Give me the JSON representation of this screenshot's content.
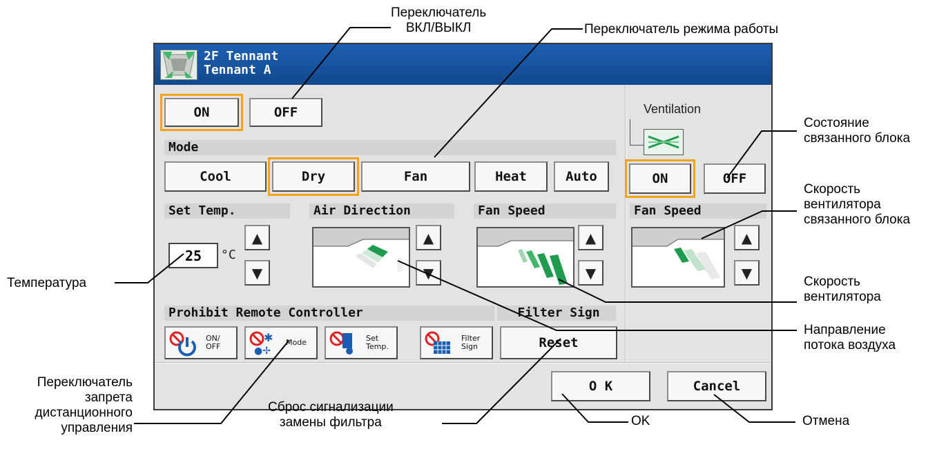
{
  "panel": {
    "title_line1": "2F Tennant",
    "title_line2": "Tennant A",
    "power": {
      "on_label": "ON",
      "off_label": "OFF",
      "selected": "ON"
    },
    "mode": {
      "section_label": "Mode",
      "options": [
        "Cool",
        "Dry",
        "Fan",
        "Heat",
        "Auto"
      ],
      "selected": "Dry"
    },
    "set_temp": {
      "section_label": "Set Temp.",
      "value": "25",
      "unit": "°C"
    },
    "air_direction": {
      "section_label": "Air Direction"
    },
    "fan_speed": {
      "section_label": "Fan Speed"
    },
    "ventilation": {
      "label": "Ventilation",
      "on_label": "ON",
      "off_label": "OFF",
      "selected": "ON",
      "fan_speed_label": "Fan Speed"
    },
    "prohibit": {
      "section_label": "Prohibit Remote Controller",
      "buttons": [
        {
          "label": "ON/\nOFF"
        },
        {
          "label": "Mode"
        },
        {
          "label": "Set\nTemp."
        },
        {
          "label": "Filter\nSign"
        }
      ]
    },
    "filter_sign": {
      "section_label": "Filter Sign",
      "reset_label": "Reset"
    },
    "ok_label": "O K",
    "cancel_label": "Cancel",
    "colors": {
      "title_bar": "#1d5fb1",
      "selection": "#f3a21c",
      "airflow": "#1f9b4e"
    }
  },
  "annotations": {
    "onoff_switch": "Переключатель\nВКЛ/ВЫКЛ",
    "mode_switch": "Переключатель режима работы",
    "linked_state": "Состояние\nсвязанного блока",
    "linked_fan": "Скорость\nвентилятора\nсвязанного блока",
    "fan_speed": "Скорость\nвентилятора",
    "air_direction": "Направление\nпотока воздуха",
    "temperature": "Температура",
    "prohibit_switch": "Переключатель\nзапрета\nдистанционного\nуправления",
    "filter_reset": "Сброс сигнализации\nзамены фильтра",
    "ok": "OK",
    "cancel": "Отмена"
  }
}
